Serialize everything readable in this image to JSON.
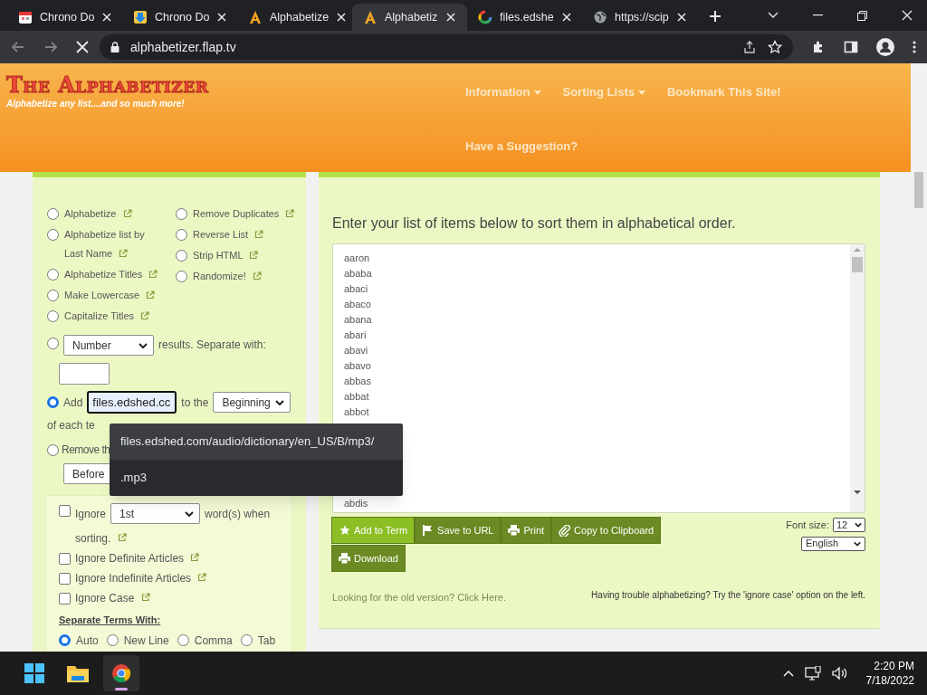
{
  "browser": {
    "tabs": [
      {
        "title": "Chrono Do",
        "selected": false
      },
      {
        "title": "Chrono Do",
        "selected": false
      },
      {
        "title": "Alphabetize",
        "selected": false
      },
      {
        "title": "Alphabetiz",
        "selected": true
      },
      {
        "title": "files.edshe",
        "selected": false
      },
      {
        "title": "https://scip",
        "selected": false
      }
    ],
    "address": "alphabetizer.flap.tv"
  },
  "site": {
    "logo": "The Alphabetizer",
    "tagline": "Alphabetize any list....and so much more!",
    "nav": [
      {
        "label": "Information",
        "dropdown": true
      },
      {
        "label": "Sorting Lists",
        "dropdown": true
      },
      {
        "label": "Bookmark This Site!",
        "dropdown": false
      },
      {
        "label": "Have a Suggestion?",
        "dropdown": false
      }
    ]
  },
  "options": {
    "column_1": [
      {
        "label": "Alphabetize",
        "selected": false
      },
      {
        "label": "Alphabetize list by Last Name",
        "selected": false
      },
      {
        "label": "Alphabetize Titles",
        "selected": false
      },
      {
        "label": "Make Lowercase",
        "selected": false
      },
      {
        "label": "Capitalize Titles",
        "selected": false
      }
    ],
    "column_2": [
      {
        "label": "Remove Duplicates",
        "selected": false
      },
      {
        "label": "Reverse List",
        "selected": false
      },
      {
        "label": "Strip HTML",
        "selected": false
      },
      {
        "label": "Randomize!",
        "selected": false
      }
    ]
  },
  "number_row": {
    "selected": false,
    "select": "Number",
    "text": "results. Separate with:"
  },
  "add_row": {
    "selected": true,
    "label": "Add",
    "value": "files.edshed.cc",
    "middle": "to the",
    "select": "Beginning",
    "trailing": "of each te"
  },
  "remove_row": {
    "selected": false,
    "label": "Remove th",
    "select": "Before"
  },
  "ignore": {
    "checked": false,
    "label": "Ignore",
    "select": "1st",
    "after": "word(s) when",
    "after_2": "sorting."
  },
  "checkboxes": [
    {
      "label": "Ignore Definite Articles",
      "checked": false
    },
    {
      "label": "Ignore Indefinite Articles",
      "checked": false
    },
    {
      "label": "Ignore Case",
      "checked": false
    }
  ],
  "separate": {
    "heading": "Separate Terms With:",
    "options": [
      {
        "label": "Auto",
        "selected": true
      },
      {
        "label": "New Line",
        "selected": false
      },
      {
        "label": "Comma",
        "selected": false
      },
      {
        "label": "Tab",
        "selected": false
      }
    ]
  },
  "main": {
    "heading": "Enter your list of items below to sort them in alphabetical order.",
    "list_top": [
      "aaron",
      "ababa",
      "abaci",
      "abaco",
      "abana",
      "abari",
      "abavi",
      "abavo",
      "abbas",
      "abbat",
      "abbot"
    ],
    "list_bottom": [
      "abdis"
    ],
    "buttons": [
      {
        "label": "Add to Term",
        "kind": "primary"
      },
      {
        "label": "Save to URL",
        "kind": "secondary"
      },
      {
        "label": "Print",
        "kind": "secondary"
      },
      {
        "label": "Copy to Clipboard",
        "kind": "secondary"
      },
      {
        "label": "Download",
        "kind": "secondary"
      }
    ],
    "font_size_label": "Font size:",
    "font_size": "12",
    "language": "English",
    "old_version": "Looking for the old version? Click Here.",
    "tip": "Having trouble alphabetizing? Try the 'ignore case' option on the left."
  },
  "autocomplete": [
    {
      "text": "files.edshed.com/audio/dictionary/en_US/B/mp3/",
      "selected": true
    },
    {
      "text": ".mp3",
      "selected": false
    }
  ],
  "taskbar": {
    "apps": [
      {
        "active": false
      },
      {
        "active": false
      },
      {
        "active": true
      }
    ],
    "time": "2:20 PM",
    "date": "7/18/2022"
  }
}
